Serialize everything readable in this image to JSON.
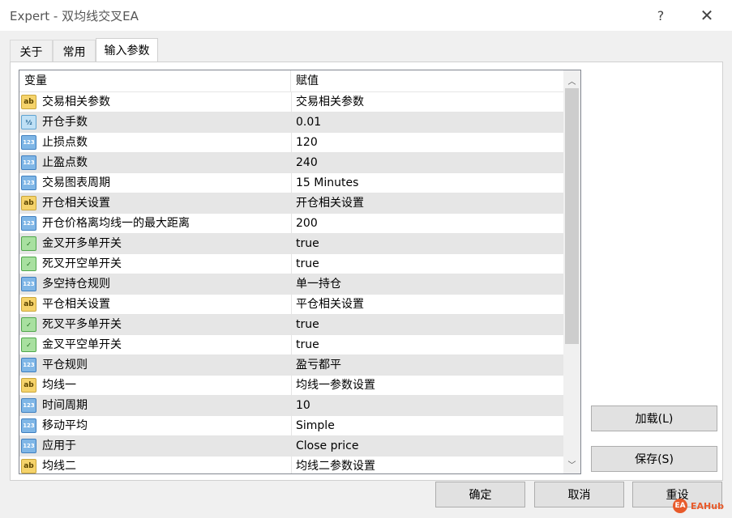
{
  "window": {
    "title": "Expert - 双均线交叉EA",
    "help_label": "?",
    "close_label": "✕"
  },
  "tabs": [
    {
      "label": "关于"
    },
    {
      "label": "常用"
    },
    {
      "label": "输入参数",
      "active": true
    }
  ],
  "grid": {
    "headers": {
      "variable": "变量",
      "value": "赋值"
    },
    "rows": [
      {
        "type": "string",
        "icon": "ab",
        "name": "交易相关参数",
        "value": "交易相关参数"
      },
      {
        "type": "double",
        "icon": "½",
        "name": "开仓手数",
        "value": "0.01"
      },
      {
        "type": "int",
        "icon": "123",
        "name": "止损点数",
        "value": "120"
      },
      {
        "type": "int",
        "icon": "123",
        "name": "止盈点数",
        "value": "240"
      },
      {
        "type": "int",
        "icon": "123",
        "name": "交易图表周期",
        "value": "15 Minutes"
      },
      {
        "type": "string",
        "icon": "ab",
        "name": "开仓相关设置",
        "value": "开仓相关设置"
      },
      {
        "type": "int",
        "icon": "123",
        "name": "开仓价格离均线一的最大距离",
        "value": "200"
      },
      {
        "type": "bool",
        "icon": "✓",
        "name": "金叉开多单开关",
        "value": "true"
      },
      {
        "type": "bool",
        "icon": "✓",
        "name": "死叉开空单开关",
        "value": "true"
      },
      {
        "type": "int",
        "icon": "123",
        "name": "多空持仓规则",
        "value": "单一持仓"
      },
      {
        "type": "string",
        "icon": "ab",
        "name": "平仓相关设置",
        "value": "平仓相关设置"
      },
      {
        "type": "bool",
        "icon": "✓",
        "name": "死叉平多单开关",
        "value": "true"
      },
      {
        "type": "bool",
        "icon": "✓",
        "name": "金叉平空单开关",
        "value": "true"
      },
      {
        "type": "int",
        "icon": "123",
        "name": "平仓规则",
        "value": "盈亏都平"
      },
      {
        "type": "string",
        "icon": "ab",
        "name": "均线一",
        "value": "均线一参数设置"
      },
      {
        "type": "int",
        "icon": "123",
        "name": "时间周期",
        "value": "10"
      },
      {
        "type": "int",
        "icon": "123",
        "name": "移动平均",
        "value": "Simple"
      },
      {
        "type": "int",
        "icon": "123",
        "name": "应用于",
        "value": "Close price"
      },
      {
        "type": "string",
        "icon": "ab",
        "name": "均线二",
        "value": "均线二参数设置"
      }
    ]
  },
  "scrollbar": {
    "up_label": "︿",
    "down_label": "﹀"
  },
  "buttons": {
    "load": "加载(L)",
    "save": "保存(S)",
    "ok": "确定",
    "cancel": "取消",
    "reset": "重设"
  },
  "watermark": {
    "text": "EAHub",
    "logo": "EA"
  }
}
